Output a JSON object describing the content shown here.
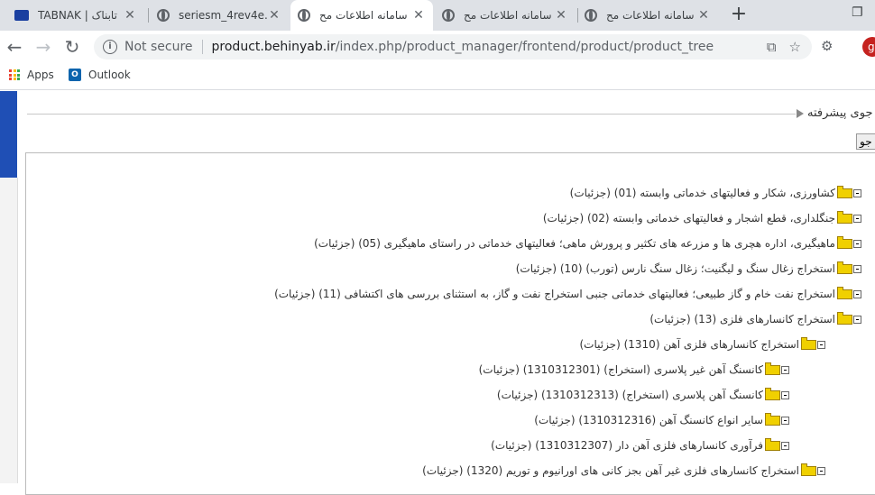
{
  "tabs": [
    {
      "title": "TABNAK | تابناک",
      "icon": "tabnak-favicon"
    },
    {
      "title": "seriesm_4rev4e.p...",
      "icon": "globe-icon"
    },
    {
      "title": "سامانه اطلاعات مح",
      "icon": "globe-icon",
      "active": true
    },
    {
      "title": "سامانه اطلاعات مح",
      "icon": "globe-icon"
    },
    {
      "title": "سامانه اطلاعات مح",
      "icon": "globe-icon"
    }
  ],
  "toolbar": {
    "not_secure": "Not secure",
    "url_host": "product.behinyab.ir",
    "url_path": "/index.php/product_manager/frontend/product/product_tree"
  },
  "bookmarks": [
    {
      "label": "Apps",
      "icon": "apps-grid-icon"
    },
    {
      "label": "Outlook",
      "icon": "outlook-icon"
    }
  ],
  "page": {
    "advanced_search_label": "جوی پیشرفته",
    "search_button_label": "جو"
  },
  "tree": [
    {
      "label": "کشاورزی، شکار و فعالیتهای خدماتی وابسته (01) (جزئیات)",
      "level": 0
    },
    {
      "label": "جنگلداری، قطع اشجار و فعالیتهای خدماتی وابسته (02) (جزئیات)",
      "level": 0
    },
    {
      "label": "ماهیگیری، اداره هچری ها و مزرعه های تکثیر و پرورش ماهی؛ فعالیتهای خدماتی در راستای ماهیگیری (05) (جزئیات)",
      "level": 0
    },
    {
      "label": "استخراج زغال سنگ و لیگنیت؛ زغال سنگ نارس (تورب) (10) (جزئیات)",
      "level": 0
    },
    {
      "label": "استخراج نفت خام و گاز طبیعی؛ فعالیتهای خدماتی جنبی استخراج نفت و گاز، به استثنای بررسی های اکتشافی (11) (جزئیات)",
      "level": 0
    },
    {
      "label": "استخراج کانسارهای فلزی (13) (جزئیات)",
      "level": 0
    },
    {
      "label": "استخراج کانسارهای فلزی آهن (1310) (جزئیات)",
      "level": 1
    },
    {
      "label": "کانسنگ آهن غیر پلاسری (استخراج) (1310312301) (جزئیات)",
      "level": 2
    },
    {
      "label": "کانسنگ آهن پلاسری (استخراج) (1310312313) (جزئیات)",
      "level": 2
    },
    {
      "label": "سایر انواع کانسنگ آهن (1310312316) (جزئیات)",
      "level": 2
    },
    {
      "label": "فرآوری کانسارهای فلزی آهن دار (1310312307) (جزئیات)",
      "level": 2
    },
    {
      "label": "استخراج کانسارهای فلزی غیر آهن بجز کانی های اورانیوم و توریم (1320) (جزئیات)",
      "level": 1
    }
  ]
}
